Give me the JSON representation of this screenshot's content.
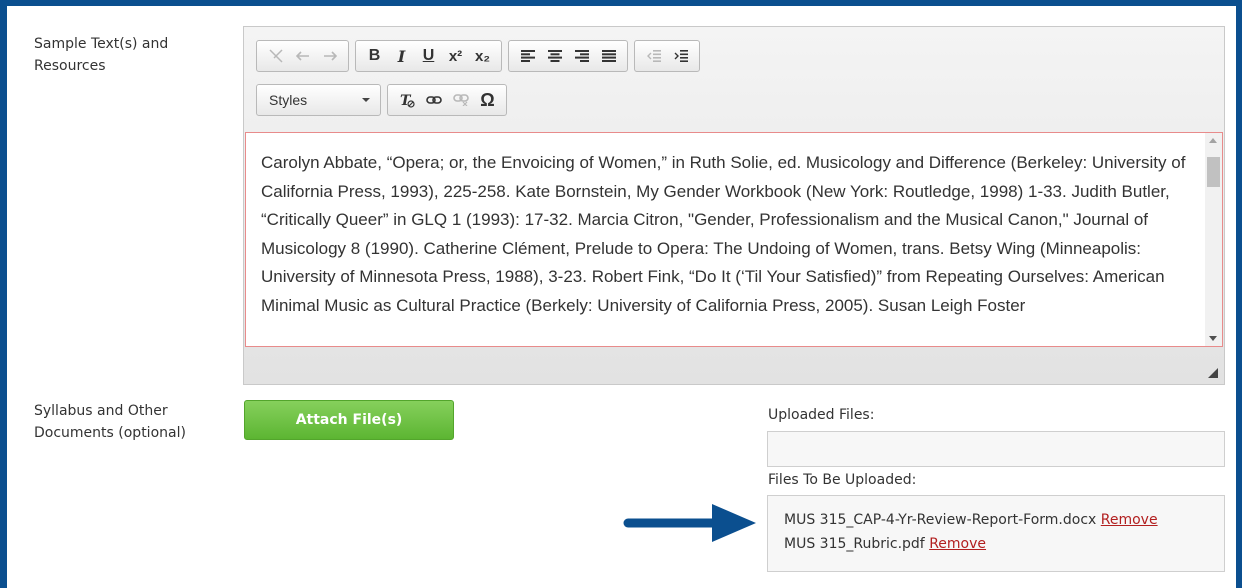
{
  "form": {
    "sample_label_line1": "Sample Text(s) and",
    "sample_label_line2": "Resources",
    "syllabus_label_line1": "Syllabus and Other",
    "syllabus_label_line2": "Documents (optional)"
  },
  "editor": {
    "toolbar": {
      "cut_icon": "scissors-icon",
      "undo_icon": "undo-icon",
      "redo_icon": "redo-icon",
      "bold": "B",
      "italic": "I",
      "underline": "U",
      "superscript": "x²",
      "subscript": "x₂",
      "styles_label": "Styles",
      "special_char": "Ω"
    },
    "content": "Carolyn Abbate, “Opera; or, the Envoicing of Women,” in Ruth Solie, ed. Musicology and Difference (Berkeley: University of California Press, 1993), 225-258. Kate Bornstein, My Gender Workbook (New York: Routledge, 1998) 1-33. Judith Butler, “Critically Queer” in GLQ 1 (1993): 17-32. Marcia Citron, \"Gender, Professionalism and the Musical Canon,\" Journal of Musicology 8 (1990). Catherine Clément, Prelude to Opera: The Undoing of Women, trans. Betsy Wing (Minneapolis: University of Minnesota Press, 1988), 3-23. Robert Fink, “Do It (‘Til Your Satisfied)” from Repeating Ourselves: American Minimal Music as Cultural Practice (Berkely: University of California Press, 2005). Susan Leigh Foster"
  },
  "attach": {
    "button_label": "Attach File(s)"
  },
  "files": {
    "uploaded_label": "Uploaded Files:",
    "pending_label": "Files To Be Uploaded:",
    "pending": [
      {
        "name": "MUS 315_CAP-4-Yr-Review-Report-Form.docx",
        "remove": "Remove"
      },
      {
        "name": "MUS 315_Rubric.pdf",
        "remove": "Remove"
      }
    ]
  },
  "colors": {
    "frame": "#0b4f8f",
    "attach_button": "#6cc142",
    "remove_link": "#b21f1f",
    "arrow": "#0b4f8f"
  }
}
